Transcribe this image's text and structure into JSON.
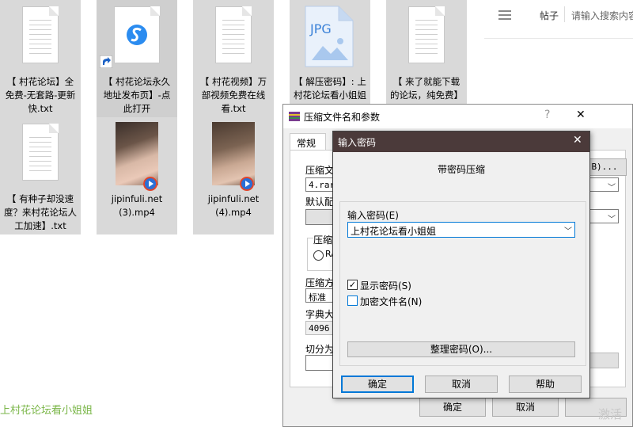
{
  "desktop": {
    "files": [
      {
        "label": "【 村花论坛】全免费-无套路-更新快.txt"
      },
      {
        "label": "【 村花论坛永久地址发布页】-点此打开"
      },
      {
        "label": "【 村花视频】万部视频免费在线看.txt"
      },
      {
        "label": "【 解压密码】: 上村花论坛看小姐姐",
        "badge": "JPG"
      },
      {
        "label": "【 来了就能下载的论坛，纯免费】"
      },
      {
        "label": "【 有种子却没速度？来村花论坛人工加速】.txt"
      },
      {
        "label": "jipinfuli.net (3).mp4"
      },
      {
        "label": "jipinfuli.net (4).mp4"
      }
    ],
    "overlay_text": "上村花论坛看小姐姐",
    "watermark": "激活"
  },
  "topbar": {
    "tab": "帖子",
    "search_placeholder": "请输入搜索内容"
  },
  "archive_window": {
    "title": "压缩文件名和参数",
    "tab_general": "常规",
    "label_archive_name": "压缩文",
    "archive_name_value": "4.rar",
    "browse_label": "B)...",
    "label_default_profile": "默认配",
    "label_compression": "压缩",
    "radio_rar": "RA",
    "label_method": "压缩方",
    "method_value": "标准",
    "label_dictionary": "字典大",
    "dictionary_value": "4096",
    "label_split": "切分为",
    "ok_label": "确定",
    "cancel_label": "取消"
  },
  "password_dialog": {
    "title": "输入密码",
    "heading": "带密码压缩",
    "password_label": "输入密码(E)",
    "password_value": "上村花论坛看小姐姐",
    "show_password_label": "显示密码(S)",
    "show_password_checked": true,
    "encrypt_names_label": "加密文件名(N)",
    "encrypt_names_checked": false,
    "organize_label": "整理密码(O)...",
    "ok_label": "确定",
    "cancel_label": "取消",
    "help_label": "帮助"
  },
  "colors": {
    "title_bar_dark": "#4b3a3a",
    "default_button_border": "#0078d7",
    "overlay_text": "#7ab648",
    "tile_background": "#d9d9d9"
  }
}
